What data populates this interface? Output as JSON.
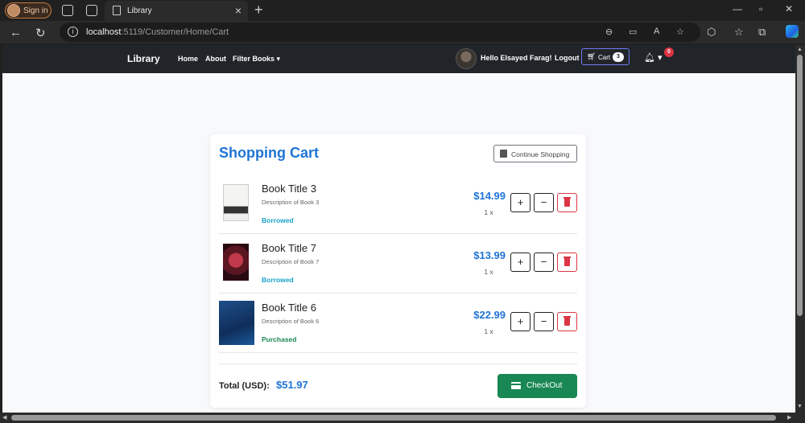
{
  "browser": {
    "signin_label": "Sign in",
    "tab_title": "Library",
    "url_host": "localhost",
    "url_rest": ":5119/Customer/Home/Cart"
  },
  "navbar": {
    "brand": "Library",
    "links": [
      "Home",
      "About",
      "Filter Books"
    ],
    "hello": "Hello Elsayed Farag!",
    "logout": "Logout",
    "cart_label": "Cart",
    "cart_count": "3",
    "notifications_count": "0"
  },
  "cart": {
    "title": "Shopping Cart",
    "continue_label": "Continue Shopping",
    "items": [
      {
        "title": "Book Title 3",
        "description": "Description of Book 3",
        "status": "Borrowed",
        "status_color": "#17a2c8",
        "price": "$14.99",
        "qty": "1 x"
      },
      {
        "title": "Book Title 7",
        "description": "Description of Book 7",
        "status": "Borrowed",
        "status_color": "#17a2c8",
        "price": "$13.99",
        "qty": "1 x"
      },
      {
        "title": "Book Title 6",
        "description": "Description of Book 6",
        "status": "Purchased",
        "status_color": "#198754",
        "price": "$22.99",
        "qty": "1 x"
      }
    ],
    "plus_label": "+",
    "minus_label": "−",
    "total_label": "Total (USD):",
    "total_value": "$51.97",
    "checkout_label": "CheckOut"
  },
  "colors": {
    "accent": "#1f74d6",
    "navbar": "#212529",
    "checkout": "#198754",
    "danger": "#dc3545"
  }
}
